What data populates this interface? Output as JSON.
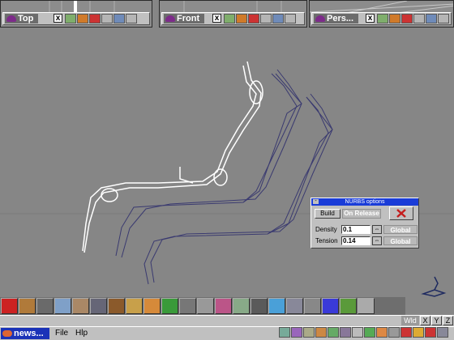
{
  "viewports": [
    {
      "label": "Top",
      "close": "x"
    },
    {
      "label": "Front",
      "close": "x"
    },
    {
      "label": "Pers...",
      "close": "x"
    }
  ],
  "nurbs_panel": {
    "title": "NURBS options",
    "minimize": "-",
    "build_label": "Build",
    "build_mode": "On Release",
    "density_label": "Density",
    "density_value": "0.1",
    "tension_label": "Tension",
    "tension_value": "0.14",
    "global_label": "Global",
    "spin_glyph": "⇔"
  },
  "status": {
    "world_label": "Wld",
    "axes": [
      "X",
      "Y",
      "Z"
    ]
  },
  "taskbar": {
    "app_label": "news...",
    "menu_file": "File",
    "menu_help": "Hlp"
  },
  "colors": {
    "background": "#868686",
    "titlebar": "#1a3cd8",
    "wire_selected": "#ffffff",
    "wire_copy": "#3a3a70"
  }
}
